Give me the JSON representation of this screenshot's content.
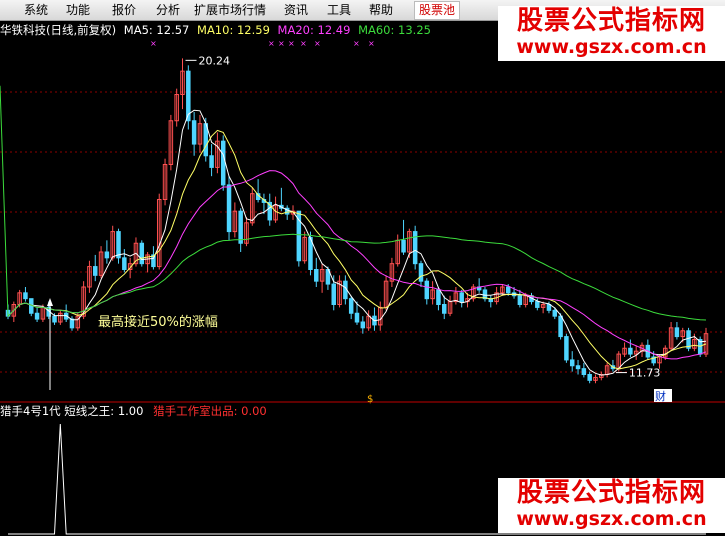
{
  "menu": {
    "items": [
      {
        "label": "系统"
      },
      {
        "label": "功能"
      },
      {
        "label": "报价"
      },
      {
        "label": "分析"
      },
      {
        "label": "扩展市场行情"
      },
      {
        "label": "资讯"
      },
      {
        "label": "工具"
      },
      {
        "label": "帮助"
      },
      {
        "label": "股票池"
      }
    ]
  },
  "info": {
    "title": "华铁科技(日线,前复权)",
    "ma5": "MA5: 12.57",
    "ma10": "MA10: 12.59",
    "ma20": "MA20: 12.49",
    "ma60": "MA60: 13.25"
  },
  "annotations": {
    "high": "20.24",
    "low": "11.73",
    "note": "最高接近50%的涨幅",
    "marker1": "$",
    "marker2": "财"
  },
  "indicator": {
    "name": "猎手4号1代",
    "label": "短线之王: 1.00",
    "author": "猎手工作室出品: 0.00"
  },
  "watermark": {
    "title": "股票公式指标网",
    "url": "www.gszx.com.cn"
  },
  "colors": {
    "background": "#000000",
    "up": "#ff5050",
    "down": "#4fd5ff",
    "ma5": "#ffffff",
    "ma10": "#ffff66",
    "ma20": "#ff40ff",
    "ma60": "#3cdc3c",
    "grid": "#8b0000",
    "brand": "#e30000"
  },
  "chart_data": {
    "type": "candlestick",
    "candles": [
      [
        11.6,
        11.8,
        11.3,
        11.4
      ],
      [
        11.4,
        11.9,
        11.2,
        11.8
      ],
      [
        11.8,
        12.3,
        11.7,
        12.2
      ],
      [
        12.2,
        12.4,
        11.9,
        12.0
      ],
      [
        12.0,
        12.0,
        11.4,
        11.5
      ],
      [
        11.5,
        11.7,
        11.2,
        11.3
      ],
      [
        11.3,
        11.8,
        11.2,
        11.7
      ],
      [
        11.7,
        11.9,
        11.3,
        11.4
      ],
      [
        11.4,
        11.5,
        11.1,
        11.2
      ],
      [
        11.2,
        11.6,
        11.1,
        11.5
      ],
      [
        11.5,
        11.8,
        11.2,
        11.3
      ],
      [
        11.3,
        11.4,
        10.9,
        11.0
      ],
      [
        11.0,
        11.5,
        10.9,
        11.4
      ],
      [
        11.4,
        12.6,
        11.3,
        12.4
      ],
      [
        12.4,
        13.3,
        12.2,
        13.1
      ],
      [
        13.1,
        13.5,
        12.6,
        12.8
      ],
      [
        12.8,
        13.8,
        12.7,
        13.6
      ],
      [
        13.6,
        14.0,
        13.2,
        13.4
      ],
      [
        13.4,
        14.5,
        13.3,
        14.3
      ],
      [
        14.3,
        14.4,
        13.2,
        13.4
      ],
      [
        13.4,
        13.7,
        12.9,
        13.0
      ],
      [
        13.0,
        13.4,
        12.7,
        13.2
      ],
      [
        13.2,
        14.1,
        13.1,
        13.9
      ],
      [
        13.9,
        14.0,
        13.1,
        13.2
      ],
      [
        13.2,
        13.6,
        12.9,
        13.5
      ],
      [
        13.5,
        13.8,
        13.0,
        13.1
      ],
      [
        13.1,
        15.6,
        13.0,
        15.4
      ],
      [
        15.4,
        16.8,
        15.2,
        16.6
      ],
      [
        16.6,
        18.3,
        16.4,
        18.1
      ],
      [
        18.1,
        19.2,
        17.9,
        19.0
      ],
      [
        19.0,
        20.24,
        18.5,
        19.8
      ],
      [
        19.8,
        20.0,
        17.8,
        18.1
      ],
      [
        18.1,
        18.4,
        16.9,
        17.3
      ],
      [
        17.3,
        18.3,
        17.0,
        18.0
      ],
      [
        18.0,
        18.2,
        16.7,
        16.9
      ],
      [
        16.9,
        17.3,
        16.2,
        16.5
      ],
      [
        16.5,
        17.7,
        16.3,
        17.4
      ],
      [
        17.4,
        17.6,
        15.7,
        15.9
      ],
      [
        15.9,
        16.2,
        14.0,
        14.3
      ],
      [
        14.3,
        15.3,
        14.1,
        15.0
      ],
      [
        15.0,
        15.1,
        13.6,
        13.9
      ],
      [
        13.9,
        14.8,
        13.8,
        14.6
      ],
      [
        14.6,
        15.8,
        14.5,
        15.6
      ],
      [
        15.6,
        16.1,
        15.3,
        15.4
      ],
      [
        15.4,
        15.6,
        14.9,
        15.3
      ],
      [
        15.3,
        15.6,
        14.5,
        14.7
      ],
      [
        14.7,
        15.5,
        14.6,
        15.2
      ],
      [
        15.2,
        15.8,
        15.0,
        15.1
      ],
      [
        15.1,
        15.2,
        14.7,
        14.9
      ],
      [
        14.9,
        15.2,
        14.7,
        15.0
      ],
      [
        15.0,
        15.0,
        13.1,
        13.3
      ],
      [
        13.3,
        14.3,
        13.2,
        14.1
      ],
      [
        14.1,
        14.3,
        12.8,
        13.0
      ],
      [
        13.0,
        13.4,
        12.4,
        12.6
      ],
      [
        12.6,
        13.2,
        12.2,
        13.0
      ],
      [
        13.0,
        13.1,
        12.3,
        12.5
      ],
      [
        12.5,
        12.8,
        11.6,
        11.8
      ],
      [
        11.8,
        12.8,
        11.7,
        12.6
      ],
      [
        12.6,
        12.8,
        11.8,
        12.0
      ],
      [
        12.0,
        12.1,
        11.3,
        11.5
      ],
      [
        11.5,
        11.9,
        11.1,
        11.2
      ],
      [
        11.2,
        11.4,
        10.8,
        11.0
      ],
      [
        11.0,
        11.6,
        10.9,
        11.4
      ],
      [
        11.4,
        11.7,
        10.9,
        11.1
      ],
      [
        11.1,
        11.9,
        10.9,
        11.7
      ],
      [
        11.7,
        12.8,
        11.6,
        12.6
      ],
      [
        12.6,
        13.4,
        12.4,
        13.2
      ],
      [
        13.2,
        14.2,
        13.1,
        14.0
      ],
      [
        14.0,
        14.7,
        13.5,
        13.6
      ],
      [
        13.6,
        14.4,
        13.4,
        14.3
      ],
      [
        14.3,
        14.5,
        13.0,
        13.2
      ],
      [
        13.2,
        13.3,
        12.4,
        12.6
      ],
      [
        12.6,
        12.7,
        11.8,
        12.0
      ],
      [
        12.0,
        12.6,
        11.8,
        12.3
      ],
      [
        12.3,
        12.4,
        11.6,
        11.8
      ],
      [
        11.8,
        12.1,
        11.3,
        11.5
      ],
      [
        11.5,
        12.1,
        11.4,
        11.9
      ],
      [
        11.9,
        12.4,
        11.8,
        12.2
      ],
      [
        12.2,
        12.3,
        11.7,
        11.9
      ],
      [
        11.9,
        12.2,
        11.7,
        12.0
      ],
      [
        12.0,
        12.5,
        11.9,
        12.4
      ],
      [
        12.4,
        12.7,
        12.2,
        12.3
      ],
      [
        12.3,
        12.4,
        11.9,
        12.0
      ],
      [
        12.0,
        12.1,
        11.7,
        11.9
      ],
      [
        11.9,
        12.4,
        11.8,
        12.2
      ],
      [
        12.2,
        12.5,
        12.1,
        12.4
      ],
      [
        12.4,
        12.5,
        12.1,
        12.2
      ],
      [
        12.2,
        12.4,
        12.0,
        12.1
      ],
      [
        12.1,
        12.3,
        11.7,
        11.8
      ],
      [
        11.8,
        12.2,
        11.7,
        12.1
      ],
      [
        12.1,
        12.2,
        11.8,
        11.9
      ],
      [
        11.9,
        12.0,
        11.6,
        11.7
      ],
      [
        11.7,
        11.9,
        11.5,
        11.8
      ],
      [
        11.8,
        11.9,
        11.5,
        11.6
      ],
      [
        11.6,
        11.7,
        11.3,
        11.4
      ],
      [
        11.4,
        11.5,
        10.6,
        10.7
      ],
      [
        10.7,
        10.8,
        9.8,
        9.9
      ],
      [
        9.9,
        10.2,
        9.5,
        9.7
      ],
      [
        9.7,
        9.9,
        9.4,
        9.6
      ],
      [
        9.6,
        9.8,
        9.3,
        9.4
      ],
      [
        9.4,
        9.5,
        9.1,
        9.2
      ],
      [
        9.2,
        9.4,
        9.1,
        9.3
      ],
      [
        9.3,
        9.5,
        9.2,
        9.4
      ],
      [
        9.4,
        9.8,
        9.3,
        9.7
      ],
      [
        9.7,
        9.9,
        9.5,
        9.6
      ],
      [
        9.6,
        10.2,
        9.5,
        10.1
      ],
      [
        10.1,
        10.5,
        10.0,
        10.3
      ],
      [
        10.3,
        10.6,
        10.0,
        10.1
      ],
      [
        10.1,
        10.4,
        9.9,
        10.2
      ],
      [
        10.2,
        10.5,
        10.0,
        10.4
      ],
      [
        10.4,
        10.6,
        9.9,
        10.0
      ],
      [
        10.0,
        10.2,
        9.7,
        9.8
      ],
      [
        9.8,
        10.1,
        9.6,
        10.0
      ],
      [
        10.0,
        10.4,
        9.9,
        10.3
      ],
      [
        10.3,
        11.2,
        10.2,
        11.0
      ],
      [
        11.0,
        11.2,
        10.6,
        10.7
      ],
      [
        10.7,
        11.0,
        10.5,
        10.9
      ],
      [
        10.9,
        11.0,
        10.2,
        10.3
      ],
      [
        10.3,
        10.8,
        10.2,
        10.6
      ],
      [
        10.6,
        10.7,
        10.0,
        10.1
      ],
      [
        10.1,
        11.0,
        10.0,
        10.8
      ]
    ],
    "price_range": [
      8.8,
      20.8
    ],
    "indicator": {
      "name": "猎手4号1代",
      "spike_index": [
        9,
        124
      ],
      "range": [
        0,
        1
      ]
    },
    "grid": "dotted"
  }
}
